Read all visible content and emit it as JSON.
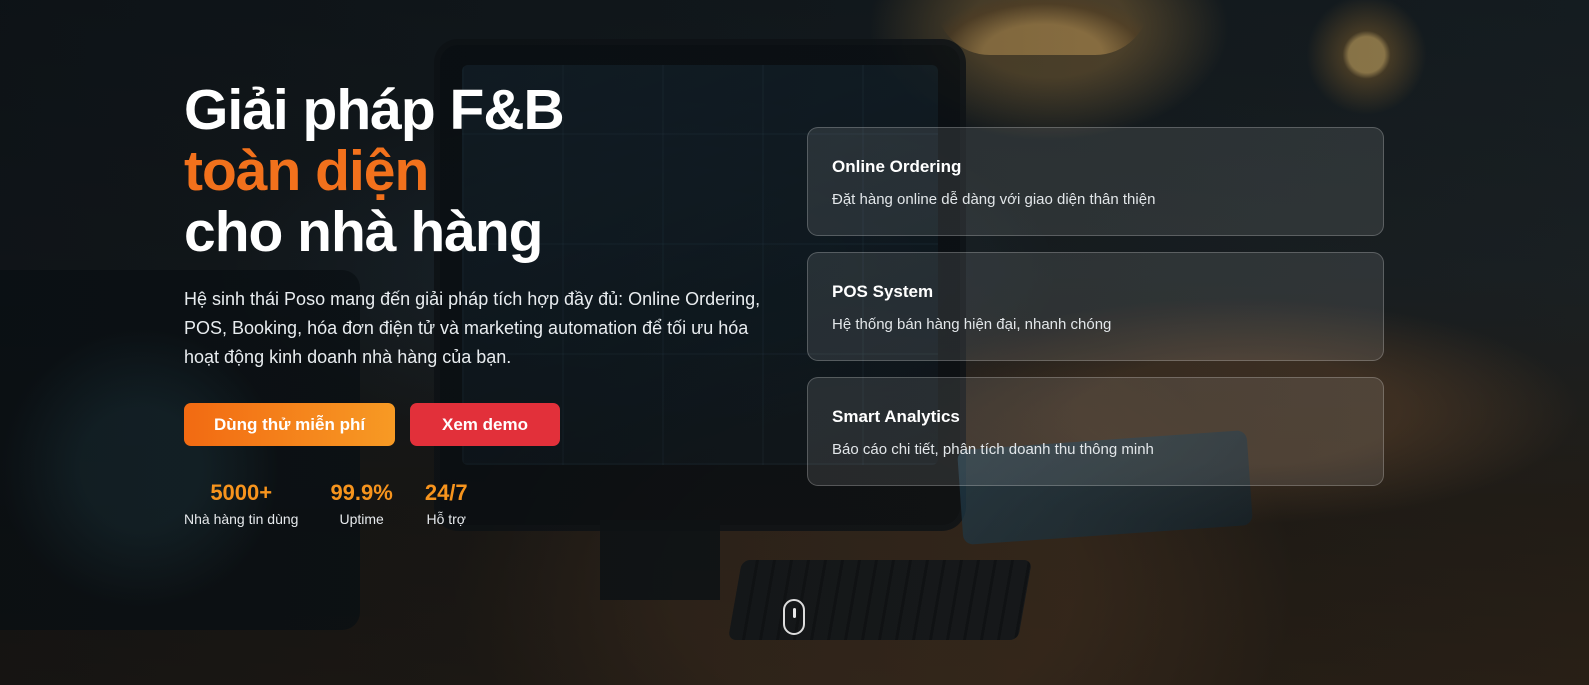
{
  "hero": {
    "title_line1": "Giải pháp F&B",
    "title_line2": "toàn diện",
    "title_line3": "cho nhà hàng",
    "description": "Hệ sinh thái Poso mang đến giải pháp tích hợp đầy đủ: Online Ordering, POS, Booking, hóa đơn điện tử và marketing automation để tối ưu hóa hoạt động kinh doanh nhà hàng của bạn.",
    "primary_button": "Dùng thử miễn phí",
    "secondary_button": "Xem demo",
    "accent_color": "#f2711c",
    "secondary_button_color": "#e2303a"
  },
  "stats": [
    {
      "value": "5000+",
      "label": "Nhà hàng tin dùng"
    },
    {
      "value": "99.9%",
      "label": "Uptime"
    },
    {
      "value": "24/7",
      "label": "Hỗ trợ"
    }
  ],
  "features": [
    {
      "title": "Online Ordering",
      "description": "Đặt hàng online dễ dàng với giao diện thân thiện"
    },
    {
      "title": "POS System",
      "description": "Hệ thống bán hàng hiện đại, nhanh chóng"
    },
    {
      "title": "Smart Analytics",
      "description": "Báo cáo chi tiết, phân tích doanh thu thông minh"
    }
  ],
  "scroll_indicator": {
    "icon": "mouse-scroll-icon"
  }
}
